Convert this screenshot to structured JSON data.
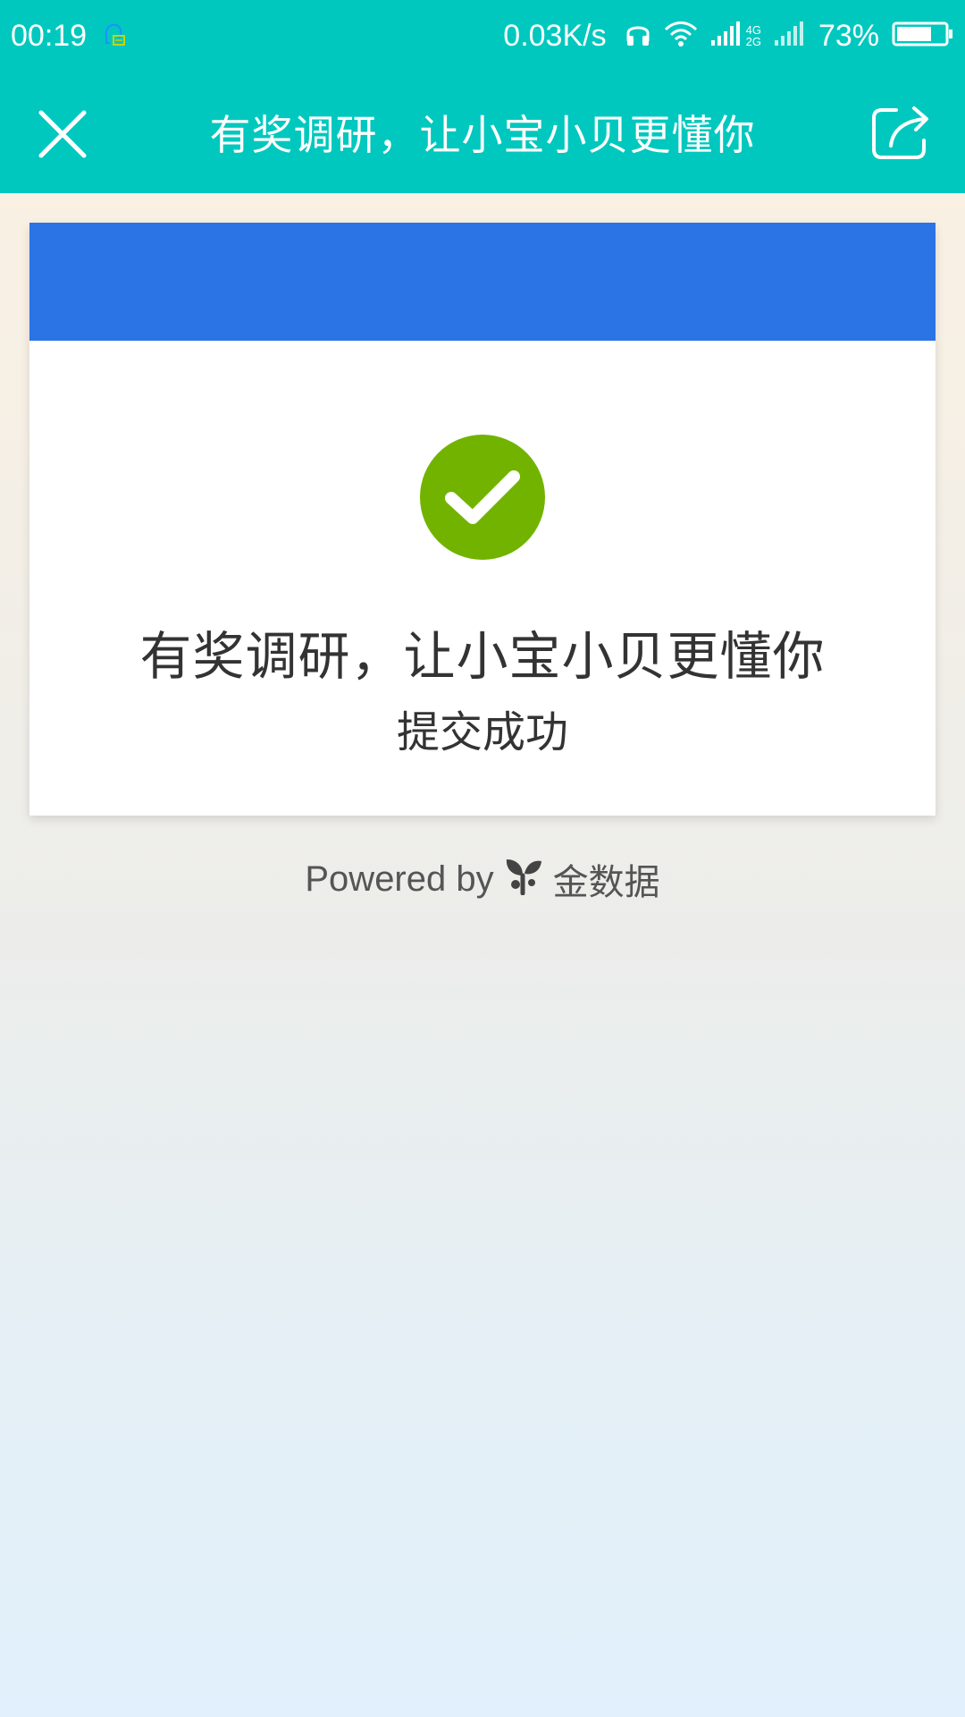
{
  "status_bar": {
    "time": "00:19",
    "network_speed": "0.03K/s",
    "network_type_top": "4G",
    "network_type_bottom": "2G",
    "battery_percent": "73%",
    "battery_level": 0.73
  },
  "toolbar": {
    "title": "有奖调研，让小宝小贝更懂你"
  },
  "card": {
    "title": "有奖调研，让小宝小贝更懂你",
    "subtitle": "提交成功"
  },
  "footer": {
    "powered_by": "Powered by",
    "brand": "金数据"
  },
  "colors": {
    "header": "#00c8be",
    "banner": "#2a74e5",
    "success": "#72b300"
  }
}
